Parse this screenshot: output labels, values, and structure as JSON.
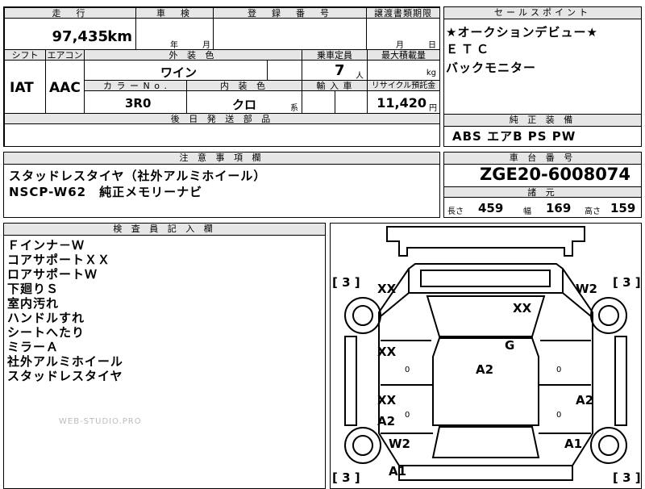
{
  "top_form": {
    "mileage_header": "走　行",
    "mileage_value": "97,435",
    "mileage_unit": "km",
    "inspection_header": "車　検",
    "inspection_year": "年",
    "inspection_month": "月",
    "registration_header": "登　録　番　号",
    "transfer_header": "譲渡書類期限",
    "transfer_month": "月",
    "transfer_day": "日",
    "shift_header": "シフト",
    "aircon_header": "エアコン",
    "exterior_color_header": "外 装 色",
    "exterior_color_value": "ワイン",
    "capacity_header": "乗車定員",
    "capacity_value": "7",
    "capacity_unit": "人",
    "max_load_header": "最大積載量",
    "max_load_unit": "kg",
    "shift_value": "IAT",
    "aircon_value": "AAC",
    "color_no_header": "カ ラ ー N o .",
    "color_no_value": "3R0",
    "interior_header": "内 装 色",
    "interior_value": "クロ",
    "interior_suffix": "系",
    "import_header": "輸 入 車",
    "recycle_header": "リサイクル預託金",
    "recycle_value": "11,420",
    "recycle_unit": "円",
    "later_parts_header": "後 日 発 送 部 品"
  },
  "sales_point": {
    "header": "セールスポイント",
    "lines": [
      "★オークションデビュー★",
      "ＥＴＣ",
      "バックモニター"
    ]
  },
  "genuine_equipment": {
    "header": "純 正 装 備",
    "value": "ABS エアB PS PW"
  },
  "notes": {
    "header": "注 意 事 項 欄",
    "lines": [
      "スタッドレスタイヤ（社外アルミホイール）",
      "NSCP-W62　純正メモリーナビ"
    ]
  },
  "chassis": {
    "header": "車 台 番 号",
    "value": "ZGE20-6008074",
    "dims_header": "諸 元",
    "length_label": "長さ",
    "length_value": "459",
    "width_label": "幅",
    "width_value": "169",
    "height_label": "高さ",
    "height_value": "159"
  },
  "inspector": {
    "header": "検 査 員 記 入 欄",
    "lines": [
      "Ｆインナ－Ｗ",
      "コアサポートＸＸ",
      "ロアサポートＷ",
      "下廻りＳ",
      "室内汚れ",
      "ハンドルすれ",
      "シートへたり",
      "ミラーＡ",
      "社外アルミホイール",
      "スタッドレスタイヤ"
    ]
  },
  "diagram": {
    "tire_fl": "[ 3 ]",
    "tire_fr": "[ 3 ]",
    "tire_rl": "[ 3 ]",
    "tire_rr": "[ 3 ]",
    "marks": {
      "front_left_fender": "XX",
      "front_right_fender": "W2",
      "hood": "XX",
      "front_left_door": "XX",
      "roof": "G",
      "roof_center": "A2",
      "rear_left_door": "XX",
      "rear_left_door_2": "A2",
      "rear_right_door": "A2",
      "rear_left_quarter": "W2",
      "rear_right_quarter": "A1",
      "rear_bumper": "A1",
      "small_0a": "0",
      "small_0b": "0",
      "small_0c": "0",
      "small_0d": "0"
    }
  },
  "watermark": "WEB-STUDIO.PRO"
}
